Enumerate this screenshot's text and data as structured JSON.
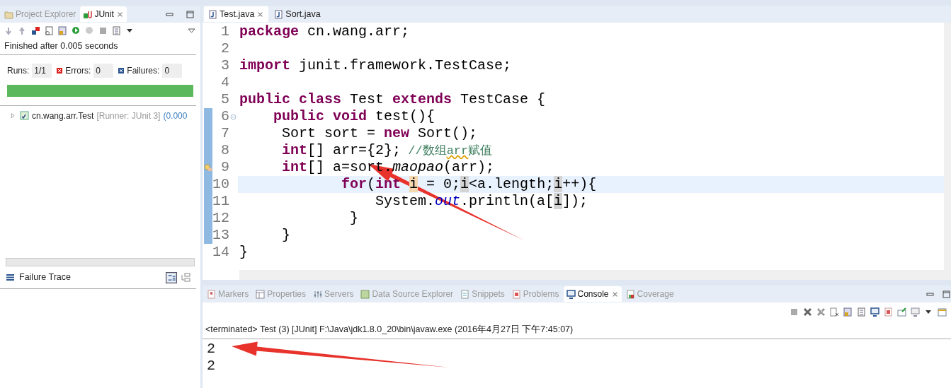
{
  "junit_panel": {
    "view_tabs": [
      {
        "label": "Project Explorer",
        "selected": false
      },
      {
        "label": "JUnit",
        "selected": true
      }
    ],
    "status": "Finished after 0.005 seconds",
    "counters": [
      {
        "kind": "runs",
        "label": "Runs:",
        "value": "1/1"
      },
      {
        "kind": "errors",
        "label": "Errors:",
        "value": "0"
      },
      {
        "kind": "failures",
        "label": "Failures:",
        "value": "0"
      }
    ],
    "progress": {
      "level": 1
    },
    "tree": [
      {
        "name": "cn.wang.arr.Test",
        "runner": "[Runner: JUnit 3]",
        "time": "(0.000",
        "expanded": false
      }
    ],
    "failure_trace": {
      "title": "Failure Trace"
    }
  },
  "editor": {
    "tabs": [
      {
        "label": "Test.java",
        "selected": true
      },
      {
        "label": "Sort.java",
        "selected": false
      }
    ],
    "lines": [
      {
        "number": "1",
        "changed": false,
        "current": false,
        "foldable": false,
        "quick_fix": false,
        "segments": [
          {
            "kind": "kw",
            "t": "package"
          },
          {
            "kind": "plain",
            "t": " cn.wang.arr;"
          }
        ]
      },
      {
        "number": "2",
        "changed": false,
        "current": false,
        "foldable": false,
        "quick_fix": false
      },
      {
        "number": "3",
        "changed": false,
        "current": false,
        "foldable": false,
        "quick_fix": false,
        "segments": [
          {
            "kind": "kw",
            "t": "import"
          },
          {
            "kind": "plain",
            "t": " junit.framework.TestCase;"
          }
        ]
      },
      {
        "number": "4",
        "changed": false,
        "current": false,
        "foldable": false,
        "quick_fix": false
      },
      {
        "number": "5",
        "changed": false,
        "current": false,
        "foldable": false,
        "quick_fix": false,
        "segments": [
          {
            "kind": "kw",
            "t": "public"
          },
          {
            "kind": "kw",
            "t": " class"
          },
          {
            "kind": "plain",
            "t": " Test"
          },
          {
            "kind": "kw",
            "t": " extends"
          },
          {
            "kind": "plain",
            "t": " TestCase {"
          }
        ]
      },
      {
        "number": "6",
        "changed": true,
        "current": false,
        "foldable": true,
        "quick_fix": false,
        "segments": [
          {
            "kind": "kw",
            "t": "    public"
          },
          {
            "kind": "kw",
            "t": " void"
          },
          {
            "kind": "plain",
            "t": " test(){"
          }
        ]
      },
      {
        "number": "7",
        "changed": true,
        "current": false,
        "foldable": false,
        "quick_fix": false,
        "segments": [
          {
            "kind": "plain",
            "t": "     Sort sort ="
          },
          {
            "kind": "kw",
            "t": " new"
          },
          {
            "kind": "plain",
            "t": " Sort();"
          }
        ]
      },
      {
        "number": "8",
        "changed": true,
        "current": false,
        "foldable": false,
        "quick_fix": false,
        "segments": [
          {
            "kind": "kw",
            "t": "     int"
          },
          {
            "kind": "plain",
            "t": "[] arr={2};"
          },
          {
            "kind": "comment",
            "t": " //数组"
          },
          {
            "kind": "spell",
            "t": "arr"
          },
          {
            "kind": "comment",
            "t": "赋值"
          }
        ]
      },
      {
        "number": "9",
        "changed": true,
        "current": false,
        "foldable": false,
        "quick_fix": true,
        "segments": [
          {
            "kind": "kw",
            "t": "     int"
          },
          {
            "kind": "plain",
            "t": "[] a=sort."
          },
          {
            "kind": "method",
            "t": "maopao"
          },
          {
            "kind": "plain",
            "t": "(arr);"
          }
        ]
      },
      {
        "number": "10",
        "changed": true,
        "current": true,
        "foldable": false,
        "quick_fix": false,
        "segments": [
          {
            "kind": "kw",
            "t": "            for"
          },
          {
            "kind": "plain",
            "t": "("
          },
          {
            "kind": "kw",
            "t": "int "
          },
          {
            "kind": "decl",
            "t": "i"
          },
          {
            "kind": "plain",
            "t": " = 0;"
          },
          {
            "kind": "occ",
            "t": "i"
          },
          {
            "kind": "plain",
            "t": "<a.length;"
          },
          {
            "kind": "occ",
            "t": "i"
          },
          {
            "kind": "plain",
            "t": "++){"
          }
        ]
      },
      {
        "number": "11",
        "changed": true,
        "current": false,
        "foldable": false,
        "quick_fix": false,
        "segments": [
          {
            "kind": "plain",
            "t": "                System."
          },
          {
            "kind": "static",
            "t": "out"
          },
          {
            "kind": "plain",
            "t": ".println(a["
          },
          {
            "kind": "occ",
            "t": "i"
          },
          {
            "kind": "plain",
            "t": "]);"
          }
        ]
      },
      {
        "number": "12",
        "changed": true,
        "current": false,
        "foldable": false,
        "quick_fix": false,
        "segments": [
          {
            "kind": "plain",
            "t": "             }"
          }
        ]
      },
      {
        "number": "13",
        "changed": true,
        "current": false,
        "foldable": false,
        "quick_fix": false,
        "segments": [
          {
            "kind": "plain",
            "t": "     }"
          }
        ]
      },
      {
        "number": "14",
        "changed": false,
        "current": false,
        "foldable": false,
        "quick_fix": false,
        "segments": [
          {
            "kind": "plain",
            "t": "}"
          }
        ]
      }
    ]
  },
  "console_panel": {
    "view_tabs": [
      {
        "label": "Markers",
        "selected": false
      },
      {
        "label": "Properties",
        "selected": false
      },
      {
        "label": "Servers",
        "selected": false
      },
      {
        "label": "Data Source Explorer",
        "selected": false
      },
      {
        "label": "Snippets",
        "selected": false
      },
      {
        "label": "Problems",
        "selected": false
      },
      {
        "label": "Console",
        "selected": true
      },
      {
        "label": "Coverage",
        "selected": false
      }
    ],
    "header": "<terminated> Test (3) [JUnit] F:\\Java\\jdk1.8.0_20\\bin\\javaw.exe (2016年4月27日 下午7:45:07)",
    "output": [
      "2",
      "2"
    ]
  }
}
